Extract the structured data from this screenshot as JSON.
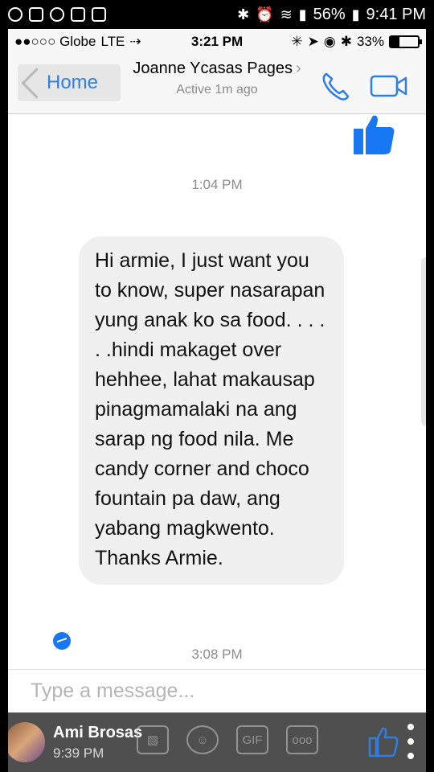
{
  "android_status": {
    "battery": "56%",
    "time": "9:41 PM"
  },
  "ios_status": {
    "carrier": "●●○○○ Globe",
    "network": "LTE",
    "time": "3:21 PM",
    "battery": "33%",
    "battery_level": 0.33
  },
  "header": {
    "back_label": "Home",
    "contact_name": "Joanne Ycasas Pages",
    "contact_chevron": "›",
    "status": "Active 1m ago"
  },
  "chat": {
    "timestamp_1": "1:04 PM",
    "message": "Hi armie, I just want you to know,  super nasarapan yung anak ko sa food.  . . . . .hindi makaget over hehhee, lahat makausap pinagmamalaki na ang sarap ng food nila. Me candy corner and choco fountain pa daw, ang yabang magkwento. Thanks Armie.",
    "timestamp_2": "3:08 PM"
  },
  "composer": {
    "placeholder": "Type a message..."
  },
  "post_overlay": {
    "poster_name": "Ami Brosas",
    "poster_time": "9:39 PM",
    "gif_label": "GIF"
  },
  "colors": {
    "accent": "#2f7fe0",
    "messenger_blue": "#1877f2",
    "bubble_bg": "#f1f0f0"
  }
}
